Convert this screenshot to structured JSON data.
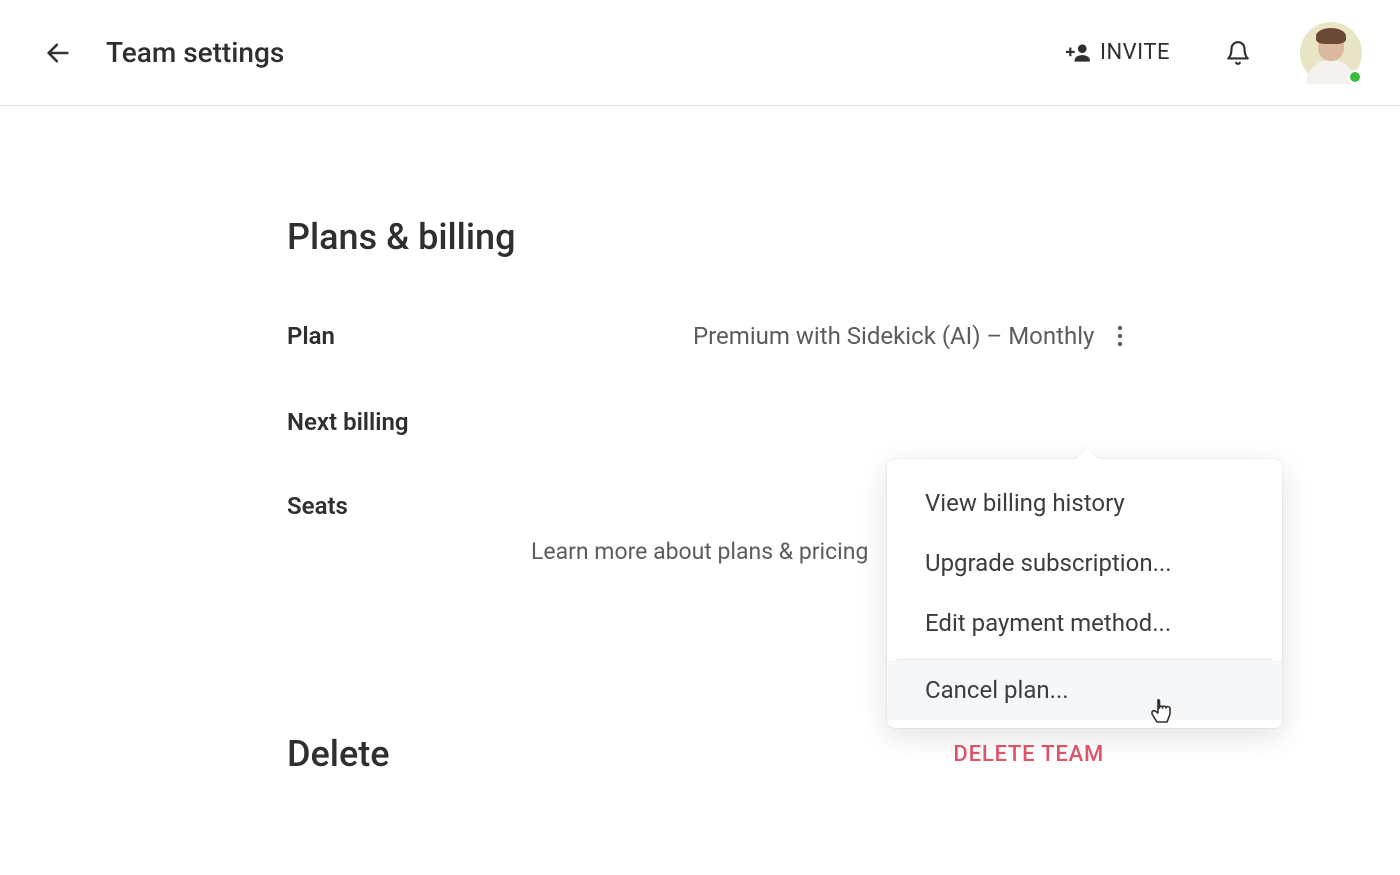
{
  "header": {
    "title": "Team settings",
    "invite_label": "INVITE"
  },
  "plans": {
    "section_title": "Plans & billing",
    "plan_label": "Plan",
    "plan_value": "Premium with Sidekick (AI) – Monthly",
    "next_billing_label": "Next billing",
    "seats_label": "Seats",
    "learn_more": "Learn more about plans & pricing"
  },
  "menu": {
    "view_history": "View billing history",
    "upgrade": "Upgrade subscription...",
    "edit_payment": "Edit payment method...",
    "cancel": "Cancel plan..."
  },
  "delete": {
    "section_title": "Delete",
    "button_label": "DELETE TEAM"
  }
}
